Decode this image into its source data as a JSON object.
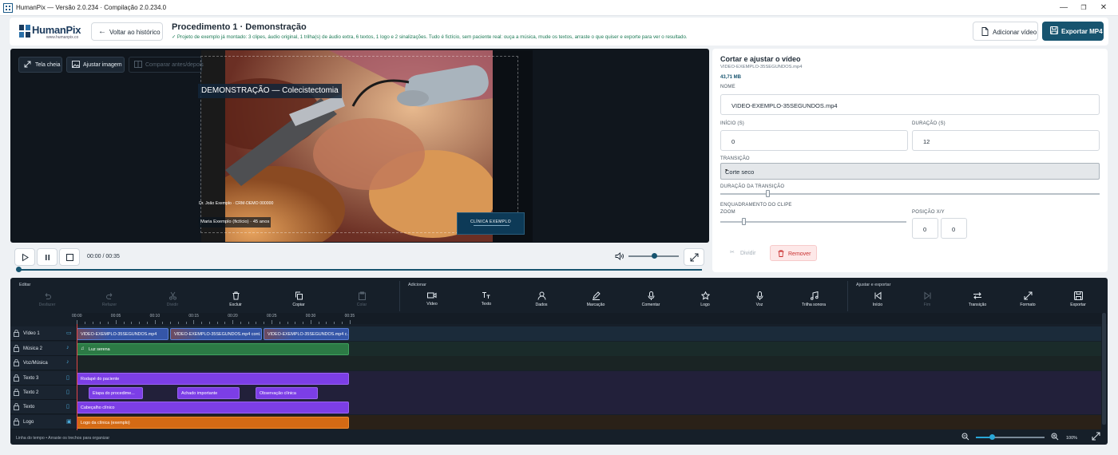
{
  "window": {
    "title": "HumanPix — Versão 2.0.234 · Compilação 2.0.234.0",
    "controls": [
      "—",
      "❐",
      "✕"
    ]
  },
  "header": {
    "logo_text": "HumanPix",
    "logo_url": "www.humanpix.co",
    "back_label": "Voltar ao histórico",
    "procedure_title": "Procedimento 1 · Demonstração",
    "procedure_note": "✓ Projeto de exemplo já montado: 3 clipes, áudio original, 1 trilha(s) de áudio extra, 6 textos, 1 logo e 2 sinalizações. Tudo é fictício, sem paciente real: ouça a música, mude os textos, arraste o que quiser e exporte para ver o resultado.",
    "add_video_label": "Adicionar vídeo",
    "export_label": "Exportar MP4",
    "accent_color": "#17546f"
  },
  "preview": {
    "fullscreen_label": "Tela cheia",
    "adjust_label": "Ajustar imagem",
    "compare_label": "Comparar antes/depois",
    "overlay_title": "DEMONSTRAÇÃO — Colecistectomia",
    "overlay_doctor": "Dr. João Exemplo · CRM-DEMO 000000",
    "overlay_patient": "Maria Exemplo (fictício) · 45 anos",
    "overlay_logo": "CLÍNICA EXEMPLO"
  },
  "transport": {
    "time": "00:00 / 00:35",
    "volume_level": 0.5,
    "progress": 0.0
  },
  "panel": {
    "title": "Cortar e ajustar o vídeo",
    "file": "VIDEO-EXEMPLO-35SEGUNDOS.mp4",
    "size": "43,71 MB",
    "name_label": "NOME",
    "name_value": "VIDEO-EXEMPLO-35SEGUNDOS.mp4",
    "start_label": "INÍCIO (S)",
    "start_value": "0",
    "duration_label": "DURAÇÃO (S)",
    "duration_value": "12",
    "transition_label": "TRANSIÇÃO",
    "transition_value": "Corte seco",
    "transition_duration_label": "DURAÇÃO DA TRANSIÇÃO",
    "transition_duration_level": 0.12,
    "framing_label": "ENQUADRAMENTO DO CLIPE",
    "zoom_label": "ZOOM",
    "zoom_level": 0.1,
    "position_label": "POSIÇÃO X/Y",
    "pos_x": "0",
    "pos_y": "0",
    "divide_label": "Dividir",
    "remove_label": "Remover"
  },
  "toolbar": {
    "groups": [
      "Editar",
      "Adicionar",
      "Ajustar e exportar"
    ],
    "edit": [
      "Desfazer",
      "Refazer",
      "Dividir",
      "Excluir",
      "Copiar",
      "Colar"
    ],
    "add": [
      "Vídeo",
      "Texto",
      "Dados",
      "Marcação",
      "Comentar",
      "Logo",
      "Voz",
      "Trilha sonora"
    ],
    "adjust": [
      "Início",
      "Fim",
      "Transição",
      "Formato",
      "Exportar"
    ]
  },
  "ruler": [
    "00:00",
    "00:05",
    "00:10",
    "00:15",
    "00:20",
    "00:25",
    "00:30",
    "00:35"
  ],
  "tracks": [
    {
      "name": "Vídeo 1",
      "clips": [
        "VIDEO-EXEMPLO-35SEGUNDOS.mp4",
        "VIDEO-EXEMPLO-35SEGUNDOS.mp4 cont...",
        "VIDEO-EXEMPLO-35SEGUNDOS.mp4 c..."
      ]
    },
    {
      "name": "Música 2",
      "clips": [
        "Luz serena"
      ]
    },
    {
      "name": "Voz/Música",
      "clips": []
    },
    {
      "name": "Texto 3",
      "clips": [
        "Rodapé do paciente"
      ]
    },
    {
      "name": "Texto 2",
      "clips": [
        "Etapa do procedime...",
        "Achado importante",
        "Observação clínica"
      ]
    },
    {
      "name": "Texto",
      "clips": [
        "Cabeçalho clínico"
      ]
    },
    {
      "name": "Logo",
      "clips": [
        "Logo da clínica (exemplo)"
      ]
    }
  ],
  "footer": {
    "hint": "Linha do tempo  •  Arraste os trechos para organizar",
    "zoom": "100%"
  }
}
